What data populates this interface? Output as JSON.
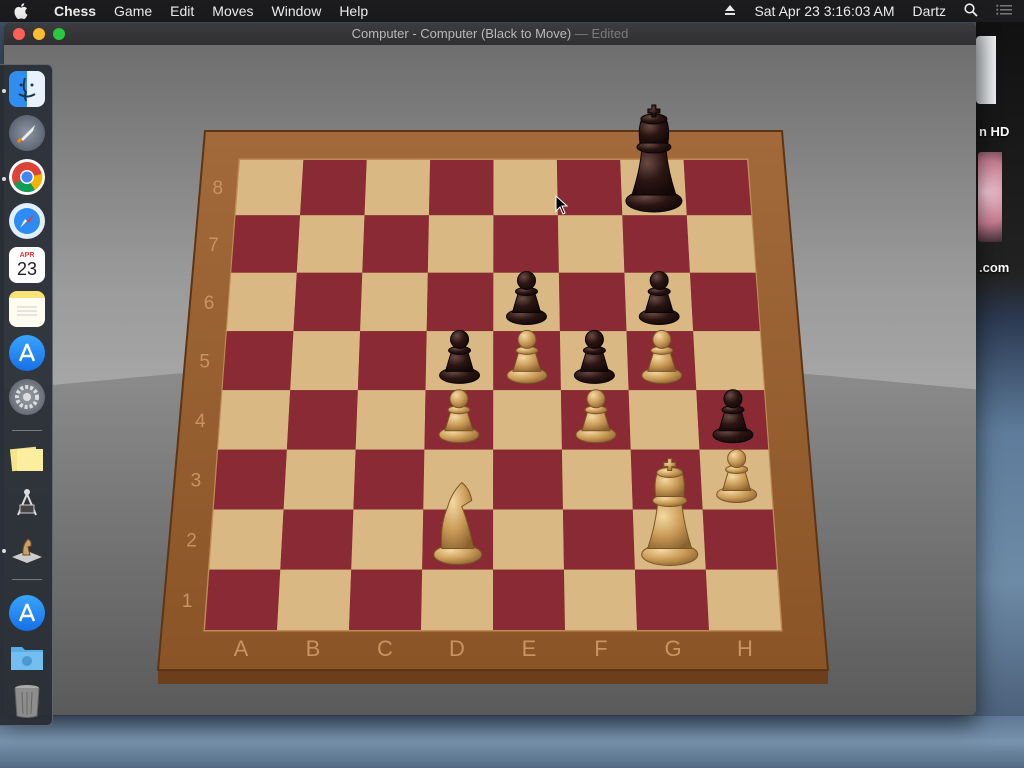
{
  "menubar": {
    "app_name": "Chess",
    "items": [
      "Game",
      "Edit",
      "Moves",
      "Window",
      "Help"
    ],
    "datetime": "Sat Apr 23  3:16:03 AM",
    "user": "Dartz"
  },
  "window": {
    "title": "Computer - Computer   (Black to Move)",
    "title_suffix": " — Edited"
  },
  "board": {
    "files": [
      "A",
      "B",
      "C",
      "D",
      "E",
      "F",
      "G",
      "H"
    ],
    "ranks": [
      "8",
      "7",
      "6",
      "5",
      "4",
      "3",
      "2",
      "1"
    ],
    "light_square_color": "#d9b884",
    "dark_square_color": "#8a2a34",
    "pieces": [
      {
        "square": "g8",
        "color": "black",
        "type": "king"
      },
      {
        "square": "e6",
        "color": "black",
        "type": "pawn"
      },
      {
        "square": "g6",
        "color": "black",
        "type": "pawn"
      },
      {
        "square": "d5",
        "color": "black",
        "type": "pawn"
      },
      {
        "square": "e5",
        "color": "white",
        "type": "pawn"
      },
      {
        "square": "f5",
        "color": "black",
        "type": "pawn"
      },
      {
        "square": "g5",
        "color": "white",
        "type": "pawn"
      },
      {
        "square": "d4",
        "color": "white",
        "type": "pawn"
      },
      {
        "square": "f4",
        "color": "white",
        "type": "pawn"
      },
      {
        "square": "h4",
        "color": "black",
        "type": "pawn"
      },
      {
        "square": "h3",
        "color": "white",
        "type": "pawn"
      },
      {
        "square": "d2",
        "color": "white",
        "type": "knight"
      },
      {
        "square": "g2",
        "color": "white",
        "type": "king"
      }
    ]
  },
  "desktop": {
    "labels": [
      "n HD",
      ".com"
    ]
  },
  "dock": {
    "calendar_month": "APR",
    "calendar_day": "23",
    "items": [
      "finder-icon",
      "launchpad-icon",
      "chrome-icon",
      "safari-icon",
      "calendar-icon",
      "notes-icon",
      "app-store-icon",
      "system-preferences-icon",
      "stickies-icon",
      "instruments-icon",
      "chess-icon",
      "app-store-icon",
      "downloads-folder-icon",
      "trash-icon"
    ]
  }
}
